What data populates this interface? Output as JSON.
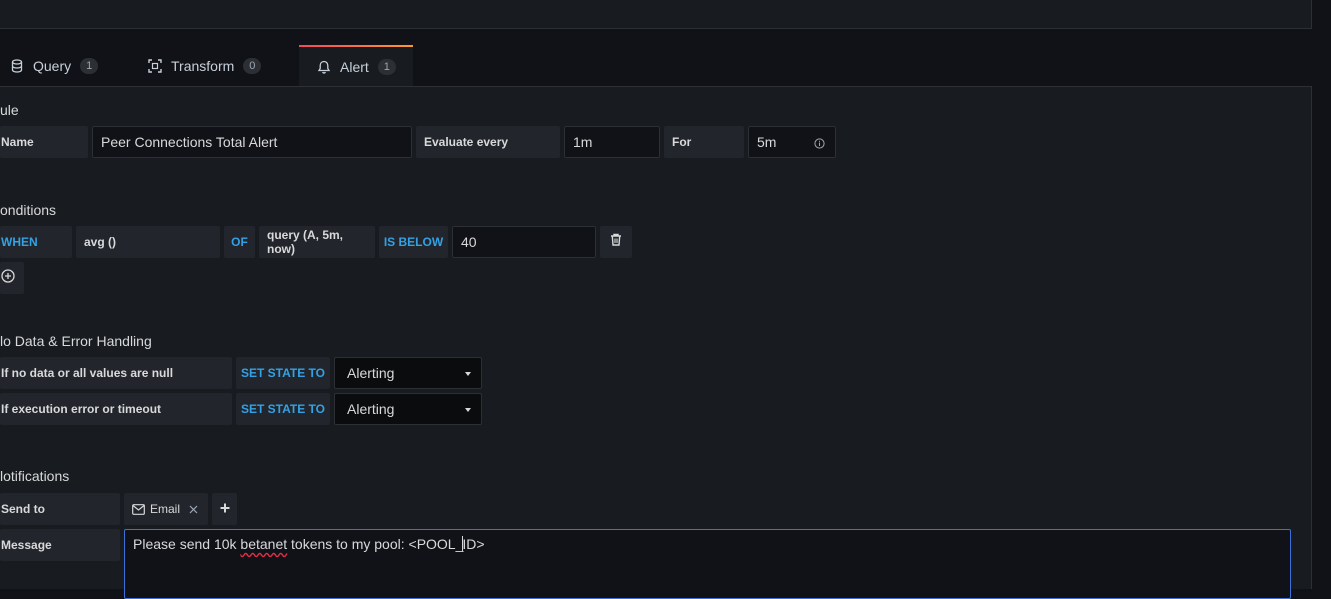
{
  "tabs": [
    {
      "label": "Query",
      "count": "1",
      "icon": "database-icon"
    },
    {
      "label": "Transform",
      "count": "0",
      "icon": "transform-icon"
    },
    {
      "label": "Alert",
      "count": "1",
      "icon": "bell-icon"
    }
  ],
  "rule": {
    "title": "ule",
    "name_label": "Name",
    "name_value": "Peer Connections Total Alert",
    "evaluate_label": "Evaluate every",
    "evaluate_value": "1m",
    "for_label": "For",
    "for_value": "5m"
  },
  "conditions": {
    "title": "onditions",
    "when": "WHEN",
    "reducer": "avg ()",
    "of": "OF",
    "query": "query (A, 5m, now)",
    "evaluator": "IS BELOW",
    "threshold": "40"
  },
  "no_data": {
    "title": "lo Data & Error Handling",
    "no_data_label": "If no data or all values are null",
    "no_data_set": "SET STATE TO",
    "no_data_state": "Alerting",
    "error_label": "If execution error or timeout",
    "error_set": "SET STATE TO",
    "error_state": "Alerting"
  },
  "notifications": {
    "title": "lotifications",
    "send_to_label": "Send to",
    "channel": "Email",
    "message_label": "Message",
    "message_before_squiggle": "Please send 10k ",
    "message_squiggle": "betanet",
    "message_mid": " tokens to my pool: <POOL_",
    "message_after_cursor": "ID>"
  },
  "colors": {
    "background": "#111217",
    "panel": "#181b1f",
    "keyword": "#33a2e5",
    "accent_gradient_start": "#f2495c",
    "accent_gradient_end": "#ff9830",
    "focus_border": "#3d71d9"
  }
}
